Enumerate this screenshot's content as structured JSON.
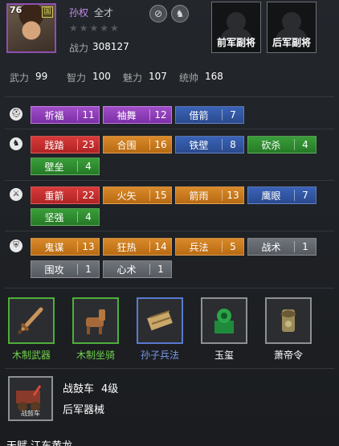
{
  "hero": {
    "level": "76",
    "seal_glyph": "国",
    "name": "孙权",
    "title": "全才",
    "stars": "★★★★★",
    "power_label": "战力",
    "power_value": "308127"
  },
  "header_buttons": [
    {
      "icon": "skill-disabled-icon",
      "glyph": "⊘"
    },
    {
      "icon": "horse-icon",
      "glyph": "♞"
    }
  ],
  "slots": {
    "front": "前军副将",
    "rear": "后军副将"
  },
  "attributes": [
    {
      "label": "武力",
      "value": "99"
    },
    {
      "label": "智力",
      "value": "100"
    },
    {
      "label": "魅力",
      "value": "107"
    },
    {
      "label": "统帅",
      "value": "168"
    }
  ],
  "skill_rows": [
    {
      "icon": "helmet-icon",
      "glyph": "⛑",
      "skills": [
        {
          "name": "祈福",
          "level": "11",
          "color": "purple"
        },
        {
          "name": "袖舞",
          "level": "12",
          "color": "purple"
        },
        {
          "name": "借箭",
          "level": "7",
          "color": "blue"
        }
      ]
    },
    {
      "icon": "horse-icon",
      "glyph": "♞",
      "skills": [
        {
          "name": "践踏",
          "level": "23",
          "color": "red"
        },
        {
          "name": "合围",
          "level": "16",
          "color": "orange"
        },
        {
          "name": "铁壁",
          "level": "8",
          "color": "blue"
        },
        {
          "name": "砍杀",
          "level": "4",
          "color": "green"
        },
        {
          "name": "壁垒",
          "level": "4",
          "color": "green"
        }
      ]
    },
    {
      "icon": "bow-icon",
      "glyph": "⚔",
      "skills": [
        {
          "name": "重箭",
          "level": "22",
          "color": "red"
        },
        {
          "name": "火矢",
          "level": "15",
          "color": "orange"
        },
        {
          "name": "箭雨",
          "level": "13",
          "color": "orange"
        },
        {
          "name": "鹰眼",
          "level": "7",
          "color": "blue"
        },
        {
          "name": "坚强",
          "level": "4",
          "color": "green"
        }
      ]
    },
    {
      "icon": "shield-icon",
      "glyph": "⛨",
      "skills": [
        {
          "name": "鬼谋",
          "level": "13",
          "color": "orange"
        },
        {
          "name": "狂热",
          "level": "14",
          "color": "orange"
        },
        {
          "name": "兵法",
          "level": "5",
          "color": "orange"
        },
        {
          "name": "战术",
          "level": "1",
          "color": "gray"
        },
        {
          "name": "围攻",
          "level": "1",
          "color": "gray"
        },
        {
          "name": "心术",
          "level": "1",
          "color": "gray"
        }
      ]
    }
  ],
  "equipment": [
    {
      "name": "木制武器",
      "icon": "sword-icon",
      "quality": "green"
    },
    {
      "name": "木制坐骑",
      "icon": "mount-icon",
      "quality": "green"
    },
    {
      "name": "孙子兵法",
      "icon": "scroll-icon",
      "quality": "blue"
    },
    {
      "name": "玉玺",
      "icon": "jade-seal-icon",
      "quality": "white"
    },
    {
      "name": "萧帝令",
      "icon": "dragon-token-icon",
      "quality": "white"
    }
  ],
  "vehicle": {
    "name": "战鼓车",
    "level": "4级",
    "type": "后军器械",
    "icon_caption": "战鼓车"
  },
  "talent_line": "天赋 江东黄龙",
  "colors": {
    "purple": "#a04ec8",
    "blue": "#3a63b8",
    "red": "#d83a3a",
    "orange": "#d98a2a",
    "green": "#3a9e3a",
    "gray": "#70747b"
  }
}
